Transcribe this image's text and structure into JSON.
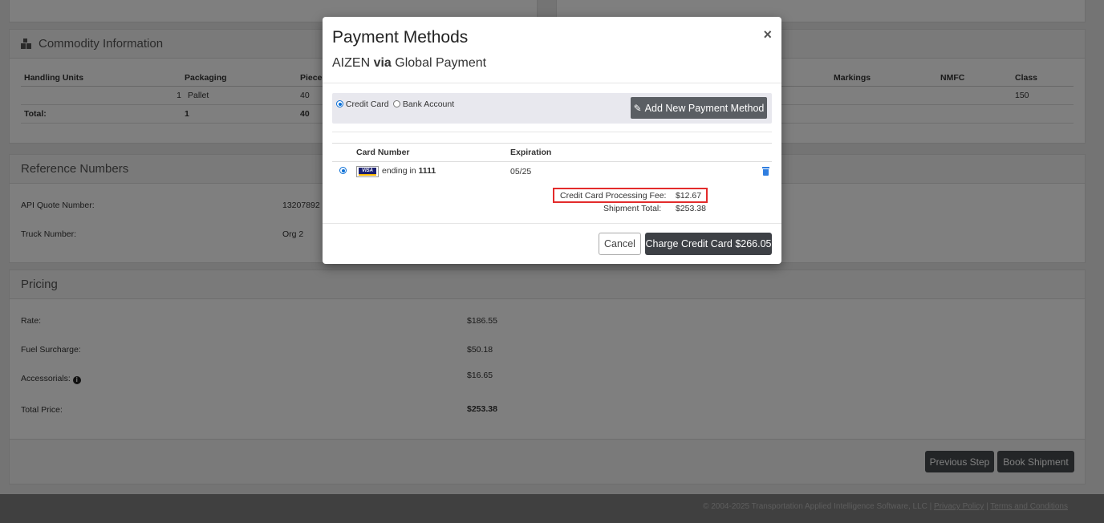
{
  "commodity": {
    "title": "Commodity Information",
    "headers": [
      "Handling Units",
      "Packaging",
      "Pieces",
      "Markings",
      "NMFC",
      "Class"
    ],
    "row": {
      "hu": "",
      "pkg_qty": "1",
      "pkg": "Pallet",
      "pieces": "40",
      "class": "150"
    },
    "total": {
      "label": "Total:",
      "hu": "1",
      "pieces": "40"
    }
  },
  "reference": {
    "title": "Reference Numbers",
    "items": [
      {
        "label": "API Quote Number:",
        "value": "13207892"
      },
      {
        "label": "Truck Number:",
        "value": "Org 2"
      }
    ]
  },
  "pricing": {
    "title": "Pricing",
    "items": [
      {
        "label": "Rate:",
        "value": "$186.55"
      },
      {
        "label": "Fuel Surcharge:",
        "value": "$50.18"
      },
      {
        "label": "Accessorials:",
        "value": "$16.65"
      },
      {
        "label": "Total Price:",
        "value": "$253.38"
      }
    ]
  },
  "nav": {
    "previous": "Previous Step",
    "book": "Book Shipment"
  },
  "footer": {
    "copyright": "© 2004-2025 Transportation Applied Intelligence Software, LLC |",
    "privacy": "Privacy Policy",
    "sep": "|",
    "terms": "Terms and Conditions"
  },
  "modal": {
    "title": "Payment Methods",
    "sub_company": "AIZEN",
    "sub_via": "via",
    "sub_provider": "Global Payment",
    "close": "×",
    "method_credit": "Credit Card",
    "method_bank": "Bank Account",
    "add_method": "Add New Payment Method",
    "col_card": "Card Number",
    "col_exp": "Expiration",
    "card_brand": "VISA",
    "ending_in": "ending in",
    "last4": "1111",
    "expiration": "05/25",
    "fee_label": "Credit Card Processing Fee:",
    "fee_value": "$12.67",
    "total_label": "Shipment Total:",
    "total_value": "$253.38",
    "cancel": "Cancel",
    "charge": "Charge Credit Card $266.05"
  },
  "colors": {
    "accent": "#0b6fd6",
    "highlight": "#e32b2b",
    "button_dark": "#3d4045"
  }
}
